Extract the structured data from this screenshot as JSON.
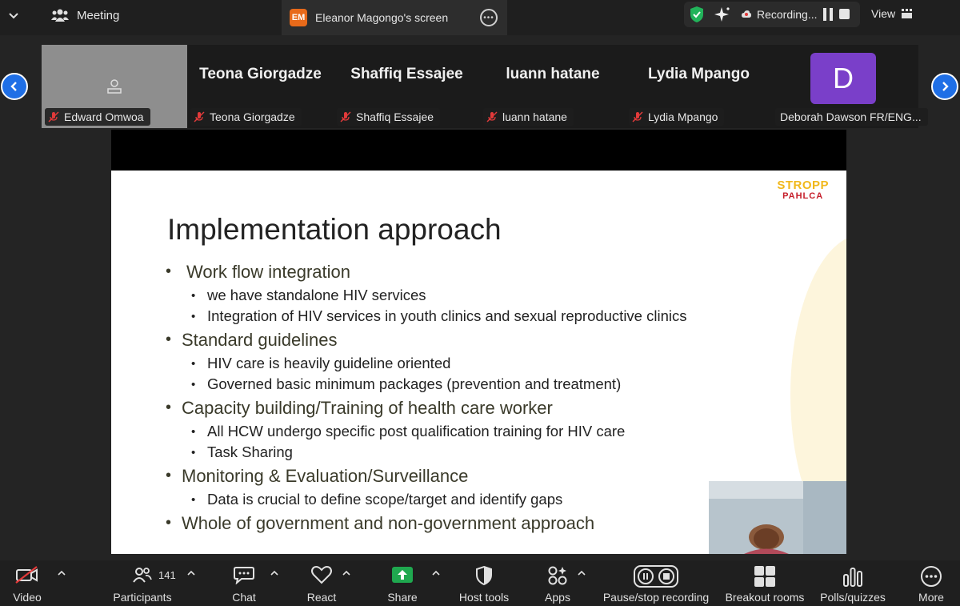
{
  "topbar": {
    "meeting_label": "Meeting",
    "share_badge": "EM",
    "share_title": "Eleanor Magongo's screen",
    "recording_label": "Recording...",
    "view_label": "View"
  },
  "participants_strip": [
    {
      "tile_name": "",
      "label": "Edward Omwoa"
    },
    {
      "tile_name": "Teona Giorgadze",
      "label": "Teona Giorgadze"
    },
    {
      "tile_name": "Shaffiq Essajee",
      "label": "Shaffiq Essajee"
    },
    {
      "tile_name": "luann hatane",
      "label": "luann hatane"
    },
    {
      "tile_name": "Lydia Mpango",
      "label": "Lydia Mpango"
    },
    {
      "tile_name": "D",
      "label": "Deborah Dawson FR/ENG..."
    }
  ],
  "slide": {
    "logo_top": "STROPP",
    "logo_bottom": "PAHLCA",
    "title": "Implementation approach",
    "bullets": [
      {
        "text": "Work flow integration",
        "sub": [
          "we have standalone HIV services",
          "Integration of HIV services in youth clinics and sexual reproductive clinics"
        ]
      },
      {
        "text": "Standard guidelines",
        "sub": [
          "HIV care is heavily guideline oriented",
          "Governed basic minimum packages (prevention and treatment)"
        ]
      },
      {
        "text": "Capacity building/Training of health care worker",
        "sub": [
          "All HCW undergo specific post qualification training for HIV care",
          "Task Sharing"
        ]
      },
      {
        "text": "Monitoring & Evaluation/Surveillance",
        "sub": [
          "Data is crucial to define scope/target and identify gaps"
        ]
      },
      {
        "text": "Whole of government  and non-government approach",
        "sub": []
      }
    ]
  },
  "toolbar": {
    "video": "Video",
    "participants": "Participants",
    "participants_count": "141",
    "chat": "Chat",
    "react": "React",
    "share": "Share",
    "host_tools": "Host tools",
    "apps": "Apps",
    "pause_recording": "Pause/stop recording",
    "breakout_rooms": "Breakout rooms",
    "polls": "Polls/quizzes",
    "more": "More"
  },
  "colors": {
    "accent": "#1f6fe6",
    "share_green": "#1fa84f",
    "avatar_purple": "#7a3fc9",
    "badge_orange": "#e86a1a"
  }
}
